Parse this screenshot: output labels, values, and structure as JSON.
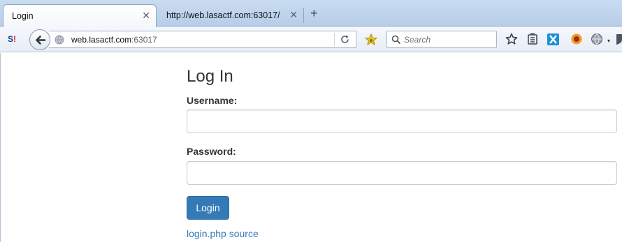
{
  "tabs": [
    {
      "label": "Login",
      "active": true
    },
    {
      "label": "http://web.lasactf.com:63017/",
      "active": false
    }
  ],
  "new_tab_symbol": "+",
  "close_symbol": "✕",
  "toolbar": {
    "addon_label": "S",
    "addon_bang": "!",
    "url_host": "web.lasactf.com",
    "url_port": ":63017",
    "search_placeholder": "Search",
    "menu_arrow": "▾",
    "icons": [
      "back-arrow-icon",
      "globe-icon",
      "reload-icon",
      "yellow-star-icon",
      "search-icon",
      "bookmark-star-icon",
      "reading-list-icon",
      "blue-x-icon",
      "orange-addon-icon",
      "globe-menu-icon",
      "shield-icon"
    ]
  },
  "page": {
    "title": "Log In",
    "username_label": "Username:",
    "username_value": "",
    "password_label": "Password:",
    "password_value": "",
    "login_button": "Login",
    "source_link": "login.php source"
  },
  "colors": {
    "primary_button": "#337ab7",
    "link": "#337ab7",
    "tabstrip": "#c9dcf1"
  }
}
